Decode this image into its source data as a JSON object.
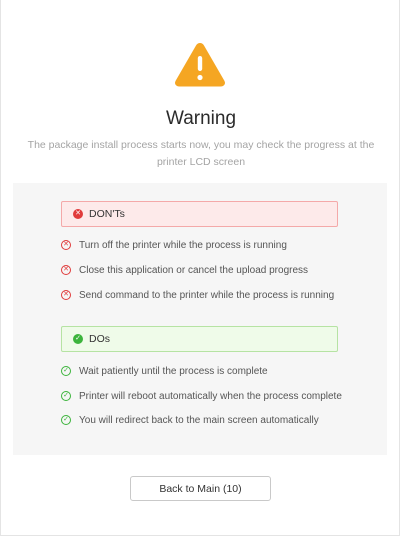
{
  "header": {
    "icon": "warning-triangle-icon",
    "icon_color": "#f5a623",
    "title": "Warning",
    "subtitle": "The package install process starts now, you may check the progress at the printer LCD screen"
  },
  "donts": {
    "label": "DON'Ts",
    "icon": "x-circle-icon",
    "color": "#e03b3b",
    "items": [
      "Turn off the printer while the process is running",
      "Close this application or cancel the upload progress",
      "Send command to the printer while the process is running"
    ]
  },
  "dos": {
    "label": "DOs",
    "icon": "check-circle-icon",
    "color": "#3cb43c",
    "items": [
      "Wait patiently until the process is complete",
      "Printer will reboot automatically when the process complete",
      "You will redirect back to the main screen automatically"
    ]
  },
  "actions": {
    "back_label": "Back to Main (10)"
  }
}
